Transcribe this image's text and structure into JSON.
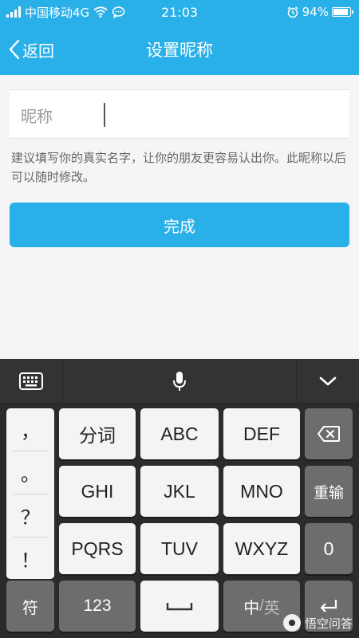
{
  "status_bar": {
    "carrier": "中国移动4G",
    "time": "21:03",
    "battery": "94%",
    "battery_level": 94,
    "icons": [
      "signal-icon",
      "wifi-icon",
      "chat-bubble-icon",
      "alarm-icon",
      "battery-icon"
    ]
  },
  "nav": {
    "back_label": "返回",
    "title": "设置昵称",
    "back_icon": "chevron-left-icon"
  },
  "form": {
    "nickname_label": "昵称",
    "nickname_value": "",
    "hint": "建议填写你的真实名字，让你的朋友更容易认出你。此昵称以后可以随时修改。",
    "submit_label": "完成"
  },
  "keyboard": {
    "toolbar_icons": [
      "keyboard-icon",
      "microphone-icon",
      "chevron-down-icon"
    ],
    "punctuation": [
      "，",
      "。",
      "？",
      "！"
    ],
    "rows": [
      [
        "分词",
        "ABC",
        "DEF"
      ],
      [
        "GHI",
        "JKL",
        "MNO"
      ],
      [
        "PQRS",
        "TUV",
        "WXYZ"
      ]
    ],
    "side_keys": {
      "backspace_icon": "backspace-icon",
      "reenter": "重输",
      "zero": "0"
    },
    "bottom": {
      "symbols": "符",
      "numbers": "123",
      "space_icon": "space-icon",
      "lang_zh": "中",
      "lang_sep": "/",
      "lang_en": "英",
      "enter_icon": "enter-icon"
    }
  },
  "watermark": {
    "text": "悟空问答",
    "logo_icon": "wukong-logo-icon"
  },
  "colors": {
    "accent": "#2ab0e8",
    "keyboard_bg": "#2b2b2b",
    "key_light": "#f4f4f4",
    "key_dark": "#6d6d6d"
  }
}
